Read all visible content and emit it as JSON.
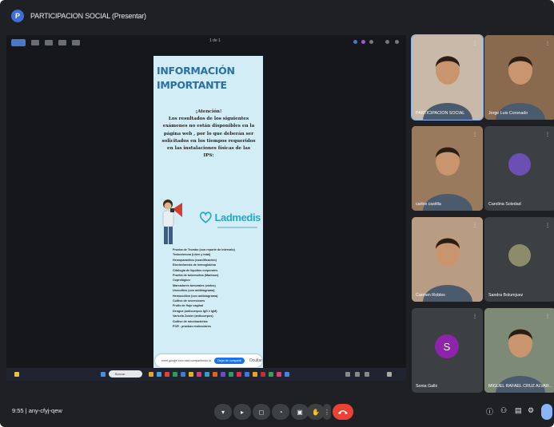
{
  "window": {
    "title": "PARTICIPACION SOCIAL (Presentar)"
  },
  "share": {
    "page_label": "1 de 1",
    "document": {
      "title": "INFORMACIÓN IMPORTANTE",
      "attention": "¡Atención!",
      "body": "Los resultados de los siguientes exámenes no están disponibles en la página web , por lo que deberán ser solicitados en los tiempos requeridos en las instalaciones físicas de las IPS:",
      "logo": "Ladmedis",
      "exams": [
        "Prueba de Trombo (con reporte de intervalo)",
        "Testosterona (Libre y total)",
        "Hemoparasitos (cuantificación)",
        "Electroforesis de hemoglobina",
        "Citología de líquidos corporales",
        "Prueba de tuberculina (Mantoux)",
        "Coprológico",
        "Marcadores tumorales (varios)",
        "Urocultivo (con antibiograma)",
        "Hemocultivo (con antibiograma)",
        "Cultivo de secreciones",
        "Frotis de flujo vaginal",
        "Dengue (anticuerpos IgG e IgM)",
        "Varicela Zoster (anticuerpos)",
        "Cultivo de micobacterias",
        "PCR - pruebas moleculares"
      ]
    },
    "popup": {
      "text": "meet.google.com está compartiendo la pantalla",
      "button": "Dejar de compartir",
      "close": "Ocultar"
    },
    "taskbar": {
      "search_placeholder": "Buscar"
    }
  },
  "participants": [
    {
      "name": "PARTICIPACIÓN SOCIAL",
      "kind": "video",
      "bg": "#c9b9a8"
    },
    {
      "name": "Jorge Luis Coronado",
      "kind": "video",
      "bg": "#8a6a4f"
    },
    {
      "name": "carlos castilla",
      "kind": "video",
      "bg": "#9a7a5c"
    },
    {
      "name": "Carolina Soledad",
      "kind": "photo",
      "bg": "#3c4043",
      "avatar": "#6c4fb3"
    },
    {
      "name": "Carmen Robles",
      "kind": "video",
      "bg": "#b89c83"
    },
    {
      "name": "Sandra Bolumjuez",
      "kind": "photo",
      "bg": "#3c4043",
      "avatar": "#8c8c6c"
    },
    {
      "name": "Sonia Gallo",
      "kind": "initial",
      "initial": "S",
      "bg": "#3c4043",
      "avatar": "#8e24aa"
    },
    {
      "name": "MIGUEL RAFAEL CRUZ ALVAR...",
      "kind": "video",
      "bg": "#7d8a78"
    }
  ],
  "meeting": {
    "time": "9:55",
    "code": "any-cfyj-qew",
    "info": "9:55  |  any-cfyj-qew"
  },
  "colors": {
    "accent": "#3d6fd8",
    "hangup": "#ea4335",
    "bg": "#1f2023"
  }
}
